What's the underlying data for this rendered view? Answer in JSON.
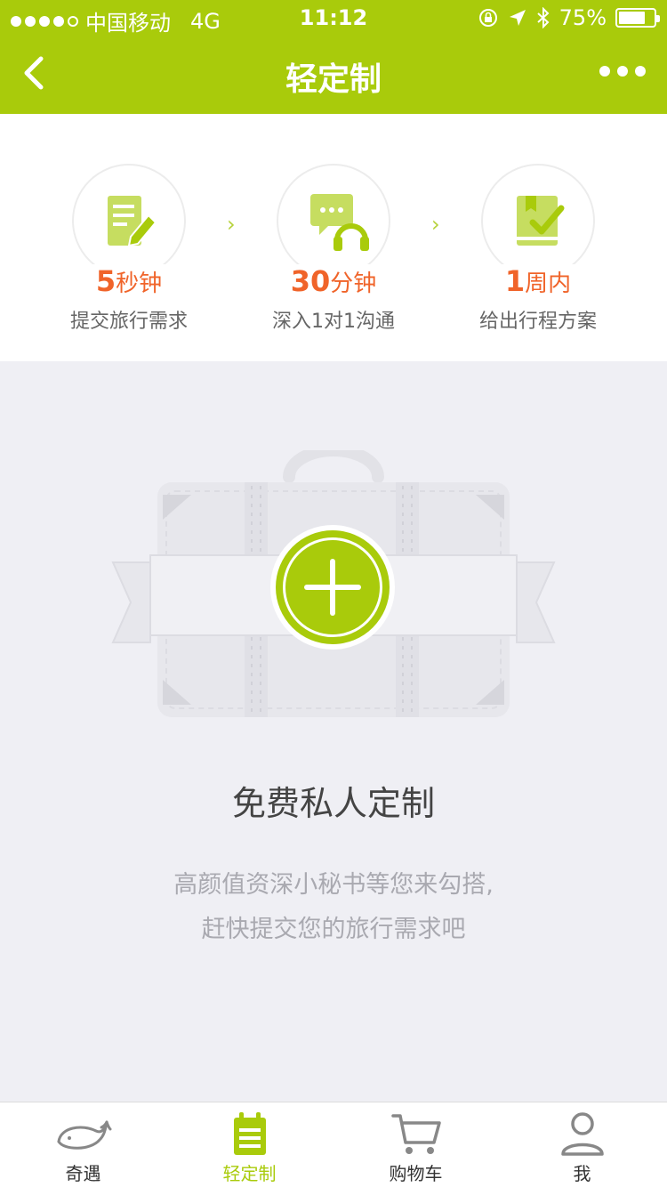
{
  "status": {
    "carrier": "中国移动",
    "network": "4G",
    "time": "11:12",
    "battery": "75%",
    "battery_level": 0.75
  },
  "nav": {
    "title": "轻定制"
  },
  "steps": [
    {
      "num": "5",
      "unit": "秒钟",
      "desc": "提交旅行需求",
      "icon": "document-pen-icon"
    },
    {
      "num": "30",
      "unit": "分钟",
      "desc": "深入1对1沟通",
      "icon": "chat-headset-icon"
    },
    {
      "num": "1",
      "unit": "周内",
      "desc": "给出行程方案",
      "icon": "book-check-icon"
    }
  ],
  "main": {
    "heading": "免费私人定制",
    "sub1": "高颜值资深小秘书等您来勾搭,",
    "sub2": "赶快提交您的旅行需求吧"
  },
  "tabs": [
    {
      "label": "奇遇",
      "icon": "whale-icon",
      "active": false
    },
    {
      "label": "轻定制",
      "icon": "calendar-list-icon",
      "active": true
    },
    {
      "label": "购物车",
      "icon": "cart-icon",
      "active": false
    },
    {
      "label": "我",
      "icon": "person-icon",
      "active": false
    }
  ],
  "colors": {
    "accent": "#a9cb0b",
    "highlight": "#f0642a",
    "background": "#efeff4"
  }
}
